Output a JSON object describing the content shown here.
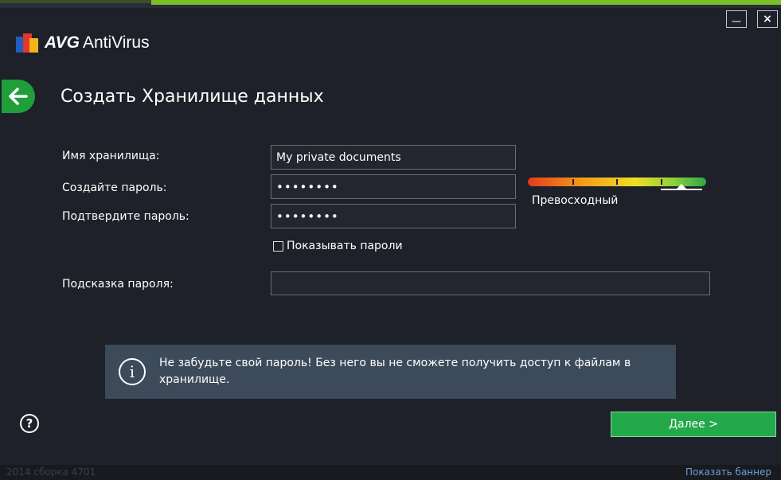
{
  "app": {
    "brand": "AVG",
    "product": "AntiVirus"
  },
  "window": {
    "minimize_label": "__",
    "close_label": "×"
  },
  "page": {
    "title": "Создать Хранилище данных"
  },
  "form": {
    "name_label": "Имя хранилища:",
    "name_value": "My private documents",
    "password_label": "Создайте пароль:",
    "password_value": "••••••••",
    "confirm_label": "Подтвердите пароль:",
    "confirm_value": "••••••••",
    "show_passwords_label": "Показывать пароли",
    "hint_label": "Подсказка пароля:",
    "hint_value": ""
  },
  "strength": {
    "label": "Превосходный",
    "level": 0.86
  },
  "info": {
    "icon": "info-icon",
    "text": "Не забудьте свой пароль! Без него вы не сможете получить доступ к файлам в хранилище."
  },
  "actions": {
    "help_label": "?",
    "next_label": "Далее >"
  },
  "footer": {
    "build": "2014  сборка 4701",
    "show_banner": "Показать баннер"
  },
  "colors": {
    "accent_green": "#24a94a",
    "top_accent": "#7bbf2a",
    "background": "#1e2129",
    "info_bg": "#3d4a5a"
  }
}
